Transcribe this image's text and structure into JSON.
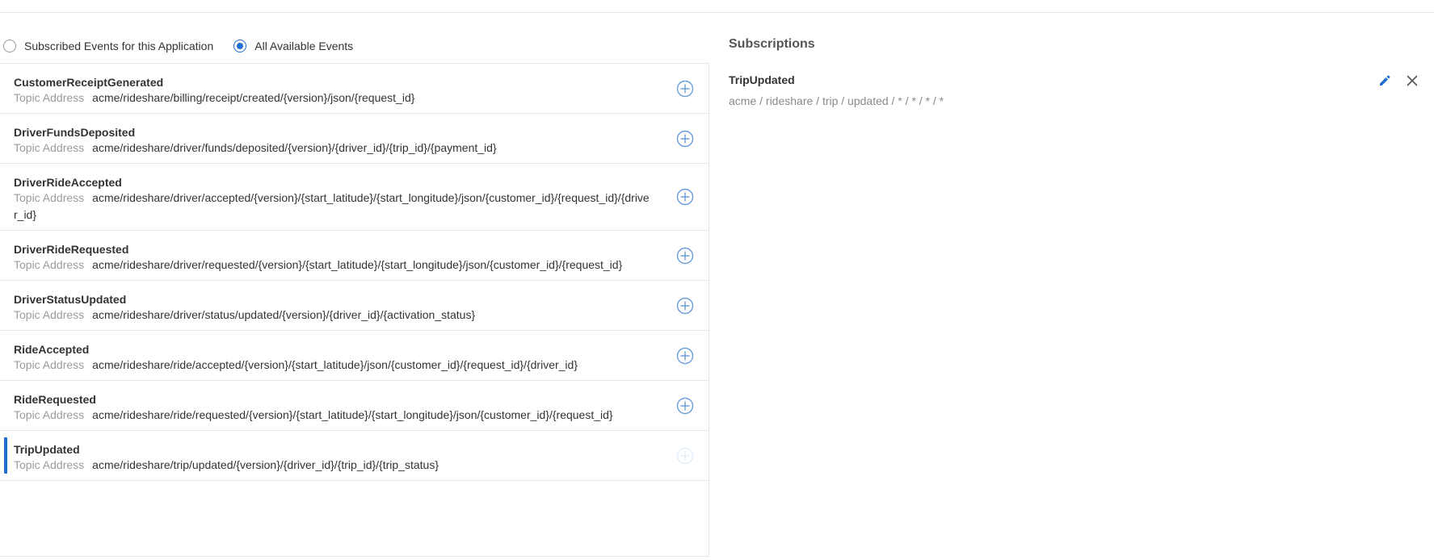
{
  "filters": {
    "subscribed_label": "Subscribed Events for this Application",
    "all_label": "All Available Events",
    "selected": "all"
  },
  "events": [
    {
      "name": "CustomerReceiptGenerated",
      "topic_label": "Topic Address",
      "topic": "acme/rideshare/billing/receipt/created/{version}/json/{request_id}",
      "selected": false
    },
    {
      "name": "DriverFundsDeposited",
      "topic_label": "Topic Address",
      "topic": "acme/rideshare/driver/funds/deposited/{version}/{driver_id}/{trip_id}/{payment_id}",
      "selected": false
    },
    {
      "name": "DriverRideAccepted",
      "topic_label": "Topic Address",
      "topic": "acme/rideshare/driver/accepted/{version}/{start_latitude}/{start_longitude}/json/{customer_id}/{request_id}/{driver_id}",
      "selected": false
    },
    {
      "name": "DriverRideRequested",
      "topic_label": "Topic Address",
      "topic": "acme/rideshare/driver/requested/{version}/{start_latitude}/{start_longitude}/json/{customer_id}/{request_id}",
      "selected": false
    },
    {
      "name": "DriverStatusUpdated",
      "topic_label": "Topic Address",
      "topic": "acme/rideshare/driver/status/updated/{version}/{driver_id}/{activation_status}",
      "selected": false
    },
    {
      "name": "RideAccepted",
      "topic_label": "Topic Address",
      "topic": "acme/rideshare/ride/accepted/{version}/{start_latitude}/json/{customer_id}/{request_id}/{driver_id}",
      "selected": false
    },
    {
      "name": "RideRequested",
      "topic_label": "Topic Address",
      "topic": "acme/rideshare/ride/requested/{version}/{start_latitude}/{start_longitude}/json/{customer_id}/{request_id}",
      "selected": false
    },
    {
      "name": "TripUpdated",
      "topic_label": "Topic Address",
      "topic": "acme/rideshare/trip/updated/{version}/{driver_id}/{trip_id}/{trip_status}",
      "selected": true
    }
  ],
  "subscriptions": {
    "title": "Subscriptions",
    "items": [
      {
        "name": "TripUpdated",
        "topic": "acme / rideshare / trip / updated / * / * / * / *"
      }
    ]
  },
  "icons": {
    "add": "add-circle-icon",
    "edit": "pencil-icon",
    "remove": "close-icon"
  },
  "colors": {
    "accent": "#1f6fd1",
    "add_icon": "#6a9fd8",
    "muted_text": "#9b9b9b"
  }
}
